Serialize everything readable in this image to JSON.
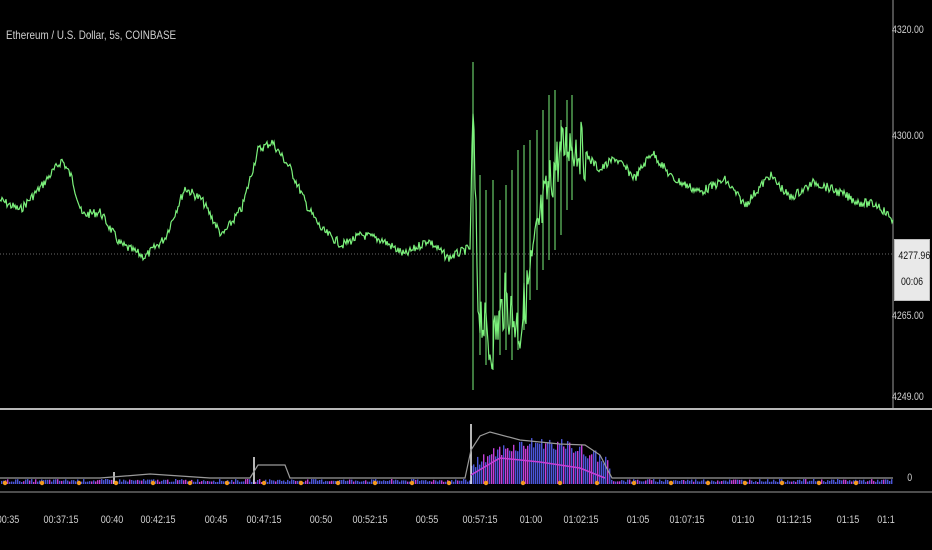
{
  "title": "Ethereum / U.S. Dollar, 5s, COINBASE",
  "price_axis": [
    "4320.00",
    "4300.00",
    "4265.00",
    "4249.00"
  ],
  "last_price": "4277.96",
  "countdown": "00:06",
  "volume_axis_label": "0",
  "time_axis": [
    "00:35",
    "00:37:15",
    "00:40",
    "00:42:15",
    "00:45",
    "00:47:15",
    "00:50",
    "00:52:15",
    "00:55",
    "00:57:15",
    "01:00",
    "01:02:15",
    "01:05",
    "01:07:15",
    "01:10",
    "01:12:15",
    "01:15",
    "01:1"
  ],
  "colors": {
    "background": "#000000",
    "price_series": "#7cf27c",
    "volume_bar": "#4b56d8",
    "volume_alt": "#c43fd6",
    "volume_dot": "#f39a1e",
    "volume_avg": "#9a9a9a",
    "separator": "#b8b8b8"
  }
}
